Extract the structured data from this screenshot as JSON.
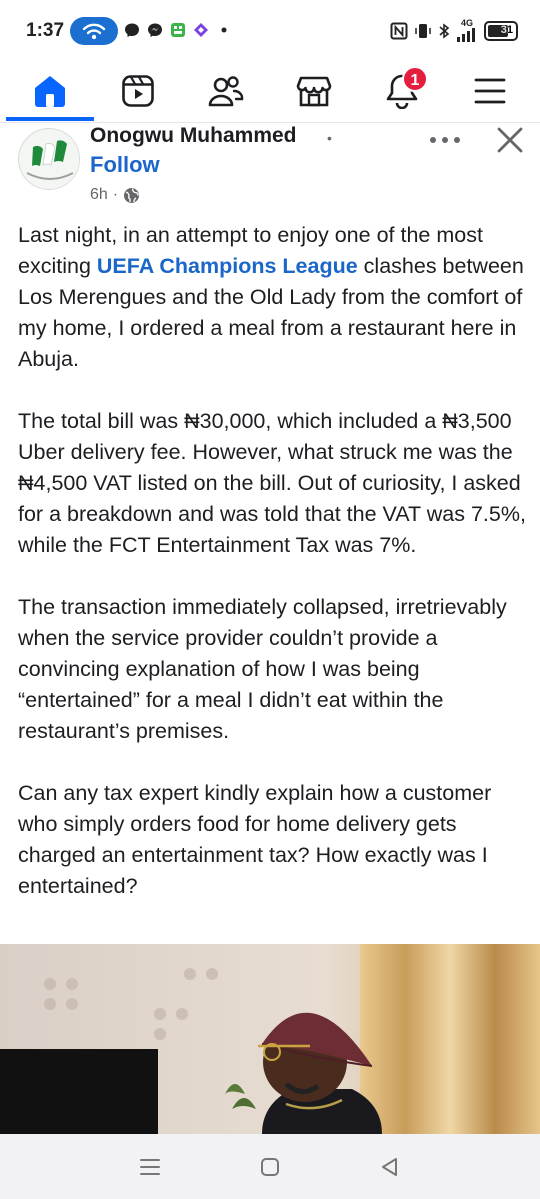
{
  "status_bar": {
    "time": "1:37",
    "network_label": "4G",
    "battery_level": "31",
    "icons": [
      "hotspot-icon",
      "messenger-icon",
      "chat-icon",
      "app-icon",
      "app-icon",
      "dot-icon",
      "nfc-icon",
      "vibrate-icon",
      "bluetooth-icon",
      "signal-icon",
      "battery-icon"
    ]
  },
  "nav": {
    "tabs": [
      {
        "name": "home",
        "icon": "home-icon",
        "active": true
      },
      {
        "name": "watch",
        "icon": "video-icon",
        "active": false
      },
      {
        "name": "friends",
        "icon": "friends-icon",
        "active": false
      },
      {
        "name": "marketplace",
        "icon": "marketplace-icon",
        "active": false
      },
      {
        "name": "notifications",
        "icon": "bell-icon",
        "active": false
      },
      {
        "name": "menu",
        "icon": "menu-icon",
        "active": false
      }
    ],
    "notification_count": "1",
    "accent_color": "#0866ff",
    "badge_color": "#e41e3f"
  },
  "post": {
    "author": "Onogwu Muhammed",
    "name_separator": "•",
    "follow_label": "Follow",
    "time": "6h",
    "time_separator": "·",
    "privacy_icon": "globe-icon",
    "paragraph1": {
      "before": "Last night, in an attempt to enjoy one of the most exciting ",
      "link": "UEFA Champions League",
      "after": " clashes between Los Merengues and the Old Lady from the comfort of my home, I ordered a meal from a restaurant here in Abuja."
    },
    "paragraph2": "The total bill was ₦30,000, which included a ₦3,500 Uber delivery fee. However, what struck me was the ₦4,500 VAT listed on the bill. Out of curiosity, I asked for a breakdown and was told that the VAT was 7.5%, while the FCT Entertainment Tax was 7%.",
    "paragraph3": "The transaction immediately collapsed, irretrievably when the service provider couldn’t provide a convincing explanation of how I was being “entertained” for a meal I didn’t eat within the restaurant’s premises.",
    "paragraph4": "Can any tax expert kindly explain how a customer who simply orders food for home delivery gets charged an entertainment tax? How exactly was I entertained?",
    "link_color": "#1b66c9"
  },
  "system_nav": {
    "buttons": [
      "recents-icon",
      "home-button-icon",
      "back-icon"
    ]
  }
}
